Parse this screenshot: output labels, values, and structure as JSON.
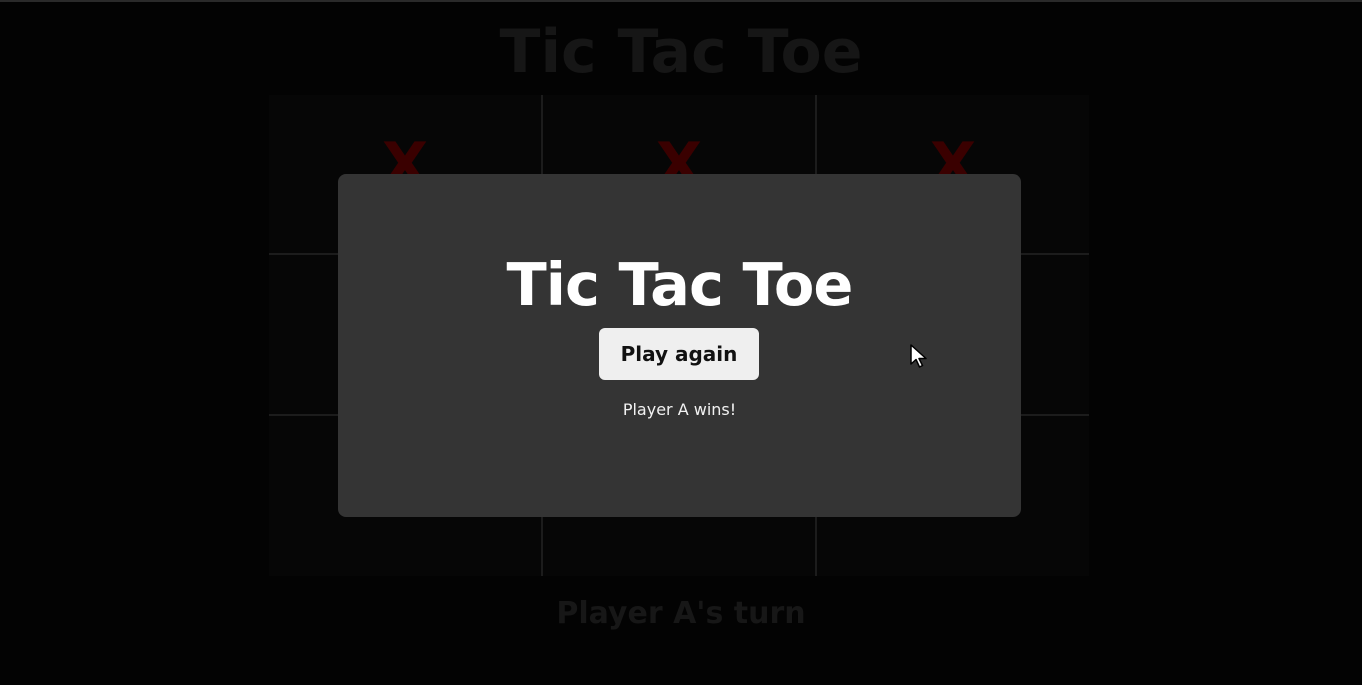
{
  "background": {
    "title": "Tic Tac Toe",
    "status": "Player A's turn",
    "board": {
      "cells": [
        "X",
        "X",
        "X",
        "",
        "",
        "",
        "",
        "",
        ""
      ]
    }
  },
  "modal": {
    "title": "Tic Tac Toe",
    "play_again_label": "Play again",
    "result_text": "Player A wins!"
  },
  "colors": {
    "overlay_background": "#000000",
    "modal_background": "#343434",
    "button_background": "#efefef",
    "mark_x": "#3a0000"
  },
  "icons": {
    "cursor": "mouse-pointer-icon"
  }
}
